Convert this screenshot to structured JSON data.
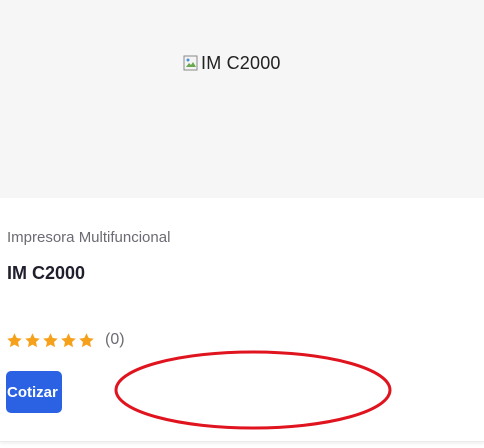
{
  "product": {
    "image_alt": "IM C2000",
    "category": "Impresora Multifuncional",
    "title": "IM C2000",
    "rating": {
      "stars_filled": 5,
      "stars_total": 5,
      "count_label": "(0)"
    },
    "quote_button_label": "Cotizar"
  },
  "icons": {
    "broken_image": "broken-image-icon",
    "star": "star-icon"
  },
  "colors": {
    "accent_button": "#2b62e3",
    "star": "#f5a11c",
    "annotation_ring": "#e0141e"
  }
}
